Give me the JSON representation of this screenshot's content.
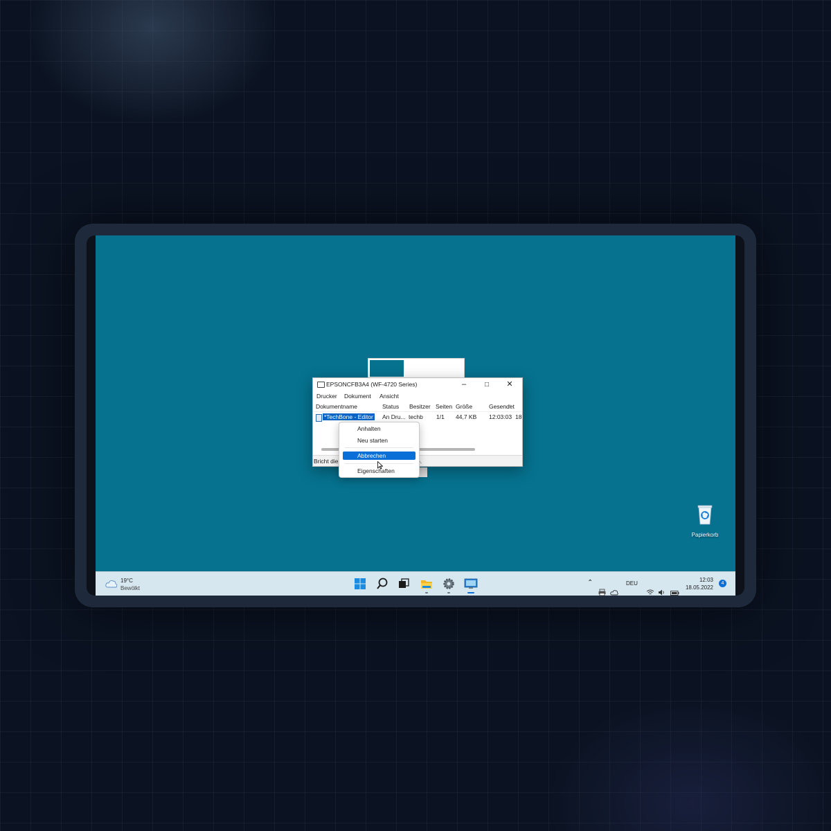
{
  "window": {
    "title": "EPSONCFB3A4 (WF-4720 Series)",
    "menus": [
      "Drucker",
      "Dokument",
      "Ansicht"
    ],
    "columns": [
      "Dokumentname",
      "Status",
      "Besitzer",
      "Seiten",
      "Größe",
      "Gesendet"
    ],
    "job": {
      "name": "*TechBone - Editor",
      "status": "An Dru...",
      "owner": "techb",
      "pages": "1/1",
      "size": "44,7 KB",
      "sent": "12:03:03",
      "sent_extra": "18"
    },
    "statusbar_left": "Bricht die",
    "statusbar_right": "b."
  },
  "context_menu": {
    "items": [
      "Anhalten",
      "Neu starten",
      "Abbrechen",
      "Eigenschaften"
    ],
    "active_item": "Abbrechen"
  },
  "desktop": {
    "recycle_bin_label": "Papierkorb"
  },
  "taskbar": {
    "weather_temp": "19°C",
    "weather_desc": "Bewölkt",
    "apps": [
      "start-icon",
      "search-icon",
      "task-view-icon",
      "file-explorer-icon",
      "settings-icon",
      "control-panel-icon"
    ],
    "language": "DEU",
    "time": "12:03",
    "date": "18.05.2022",
    "notification_count": "4"
  },
  "colors": {
    "desktop": "#06728f",
    "accent": "#0a6fd6",
    "taskbar": "#d6e7ef"
  }
}
